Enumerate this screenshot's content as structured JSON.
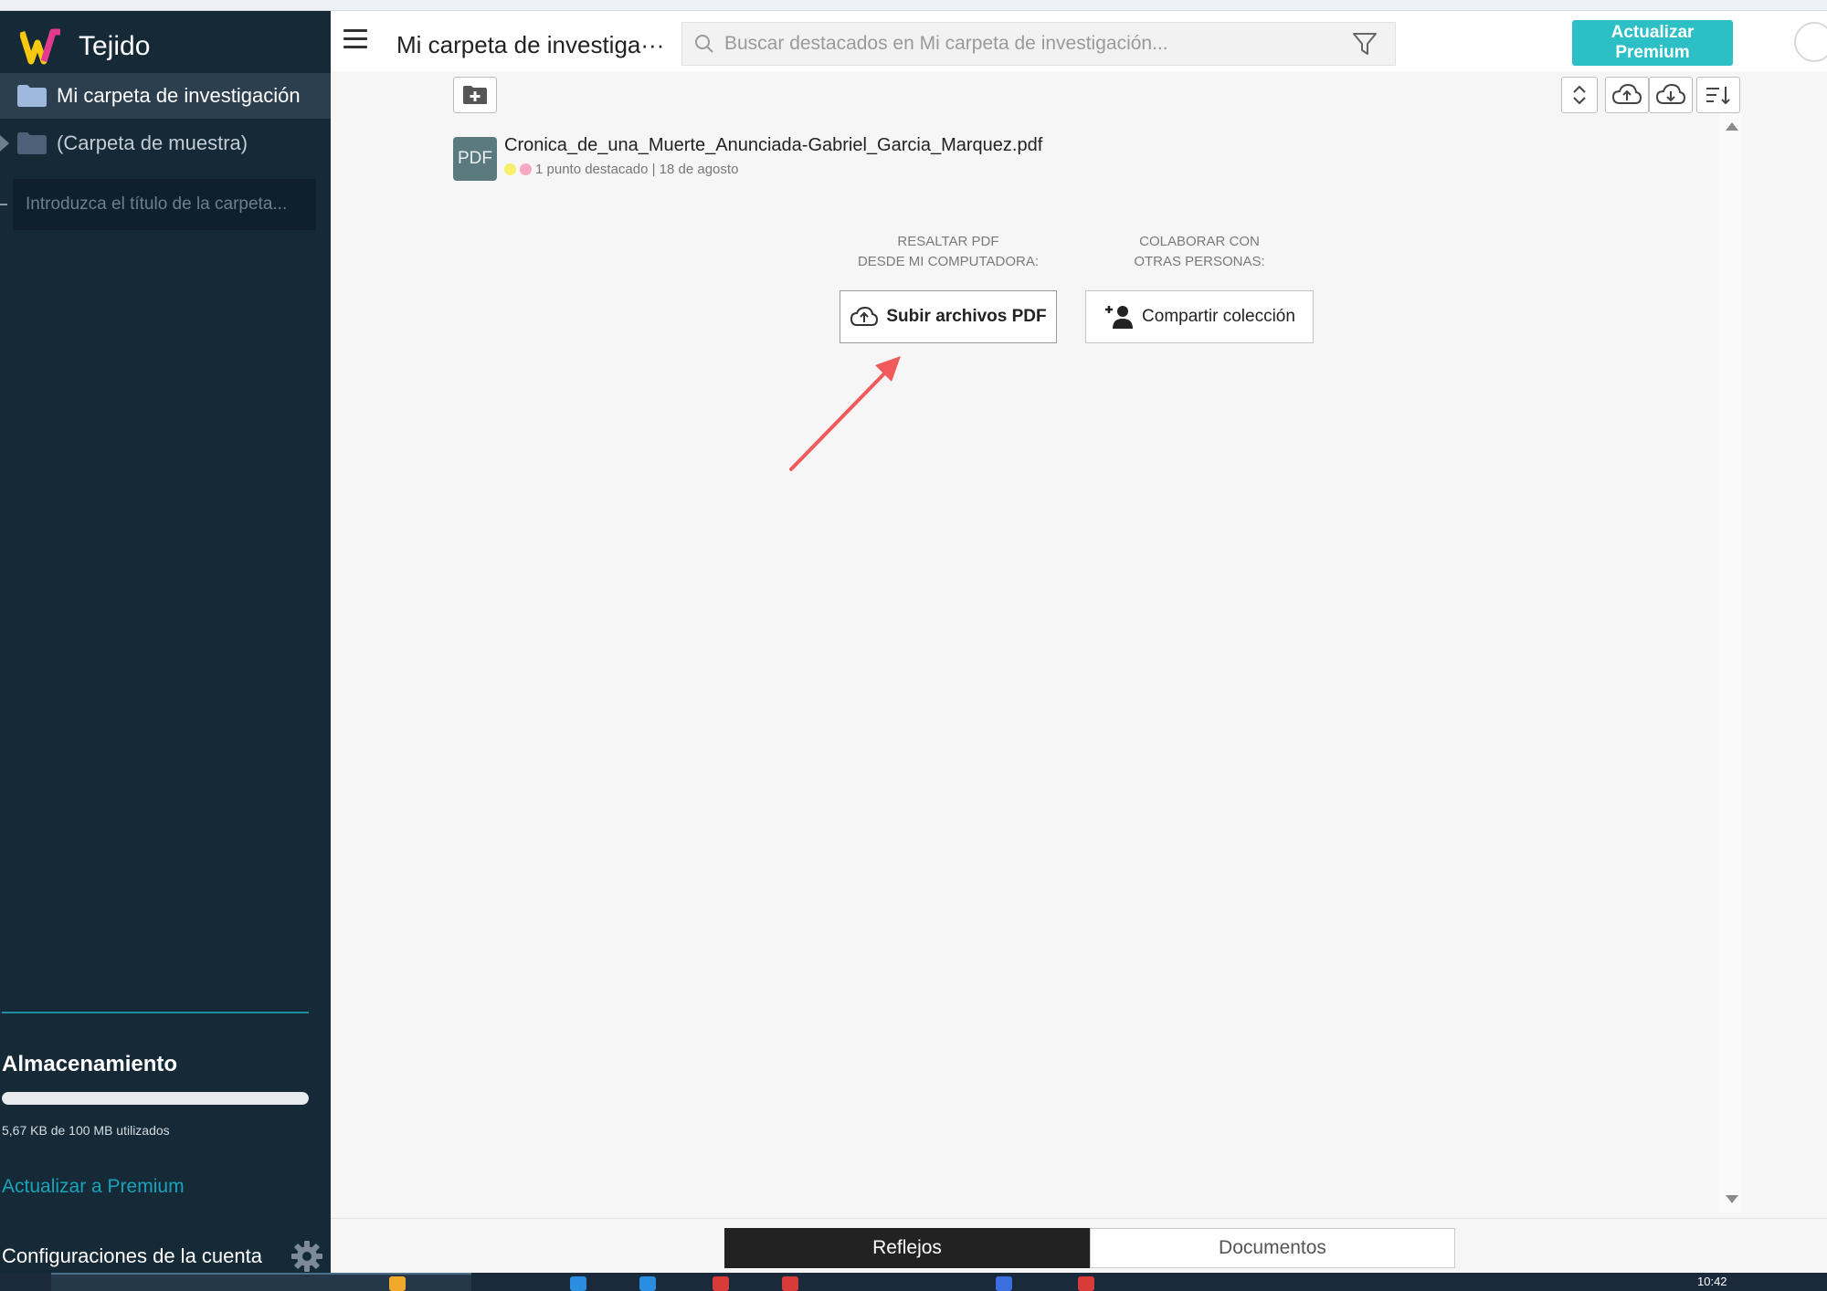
{
  "app": {
    "name": "Tejido",
    "logo_colors": [
      "#f6c90e",
      "#e5398f"
    ]
  },
  "sidebar": {
    "folders": [
      {
        "label": "Mi carpeta de investigación",
        "active": true
      },
      {
        "label": "(Carpeta de muestra)",
        "active": false
      }
    ],
    "new_folder_placeholder": "Introduzca el título de la carpeta...",
    "storage": {
      "title": "Almacenamiento",
      "used_text": "5,67 KB de 100 MB utilizados",
      "used_fraction": 0.0001,
      "upgrade_link": "Actualizar a Premium"
    },
    "settings_label": "Configuraciones de la cuenta"
  },
  "header": {
    "folder_title": "Mi carpeta de investiga···",
    "search_placeholder": "Buscar destacados en Mi carpeta de investigación...",
    "premium_button": "Actualizar Premium"
  },
  "document": {
    "badge": "PDF",
    "title": "Cronica_de_una_Muerte_Anunciada-Gabriel_Garcia_Marquez.pdf",
    "meta": "1 punto destacado | 18 de agosto",
    "dot_colors": [
      "#f7f06a",
      "#f7a8c0"
    ]
  },
  "cta": {
    "upload_label": "RESALTAR PDF\nDESDE MI COMPUTADORA:",
    "upload_line1": "RESALTAR PDF",
    "upload_line2": "DESDE MI COMPUTADORA:",
    "upload_button": "Subir archivos PDF",
    "share_line1": "COLABORAR CON",
    "share_line2": "OTRAS PERSONAS:",
    "share_button": "Compartir colección",
    "arrow_color": "#f05a5a"
  },
  "tabs": [
    {
      "label": "Reflejos",
      "active": true
    },
    {
      "label": "Documentos",
      "active": false
    }
  ],
  "taskbar": {
    "clock": "10:42"
  },
  "colors": {
    "sidebar_bg": "#152936",
    "accent": "#2cc0c6",
    "link": "#1aa3b8"
  }
}
